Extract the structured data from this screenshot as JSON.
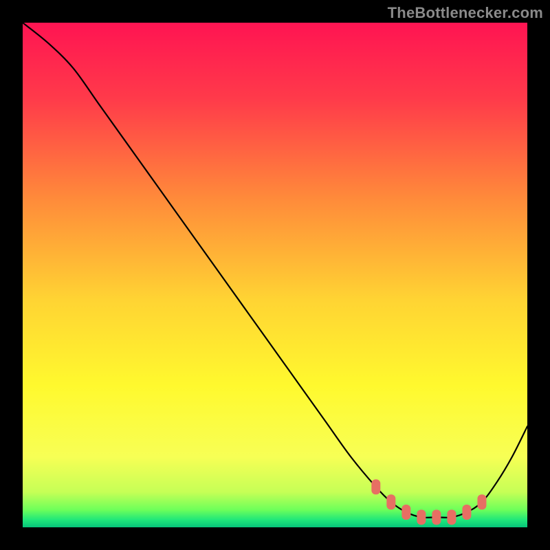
{
  "watermark": "TheBottlenecker.com",
  "chart_data": {
    "type": "line",
    "title": "",
    "xlabel": "",
    "ylabel": "",
    "xlim": [
      0,
      100
    ],
    "ylim": [
      0,
      100
    ],
    "grid": false,
    "series": [
      {
        "name": "bottleneck-curve",
        "x": [
          0,
          5,
          10,
          15,
          20,
          25,
          30,
          35,
          40,
          45,
          50,
          55,
          60,
          65,
          70,
          73,
          76,
          79,
          82,
          85,
          88,
          91,
          94,
          97,
          100
        ],
        "y": [
          100,
          96,
          91,
          84,
          77,
          70,
          63,
          56,
          49,
          42,
          35,
          28,
          21,
          14,
          8,
          5,
          3,
          2,
          2,
          2,
          3,
          5,
          9,
          14,
          20
        ]
      }
    ],
    "markers": {
      "name": "optimal-range",
      "x": [
        70,
        73,
        76,
        79,
        82,
        85,
        88,
        91
      ],
      "y": [
        8,
        5,
        3,
        2,
        2,
        2,
        3,
        5
      ]
    },
    "gradient_stops": [
      {
        "offset": 0.0,
        "color": "#ff1452"
      },
      {
        "offset": 0.15,
        "color": "#ff3a4a"
      },
      {
        "offset": 0.35,
        "color": "#ff8b3a"
      },
      {
        "offset": 0.55,
        "color": "#ffd433"
      },
      {
        "offset": 0.72,
        "color": "#fff92e"
      },
      {
        "offset": 0.86,
        "color": "#f7ff55"
      },
      {
        "offset": 0.93,
        "color": "#c6ff56"
      },
      {
        "offset": 0.965,
        "color": "#6eff5a"
      },
      {
        "offset": 0.985,
        "color": "#20e77a"
      },
      {
        "offset": 1.0,
        "color": "#06c47a"
      }
    ]
  }
}
